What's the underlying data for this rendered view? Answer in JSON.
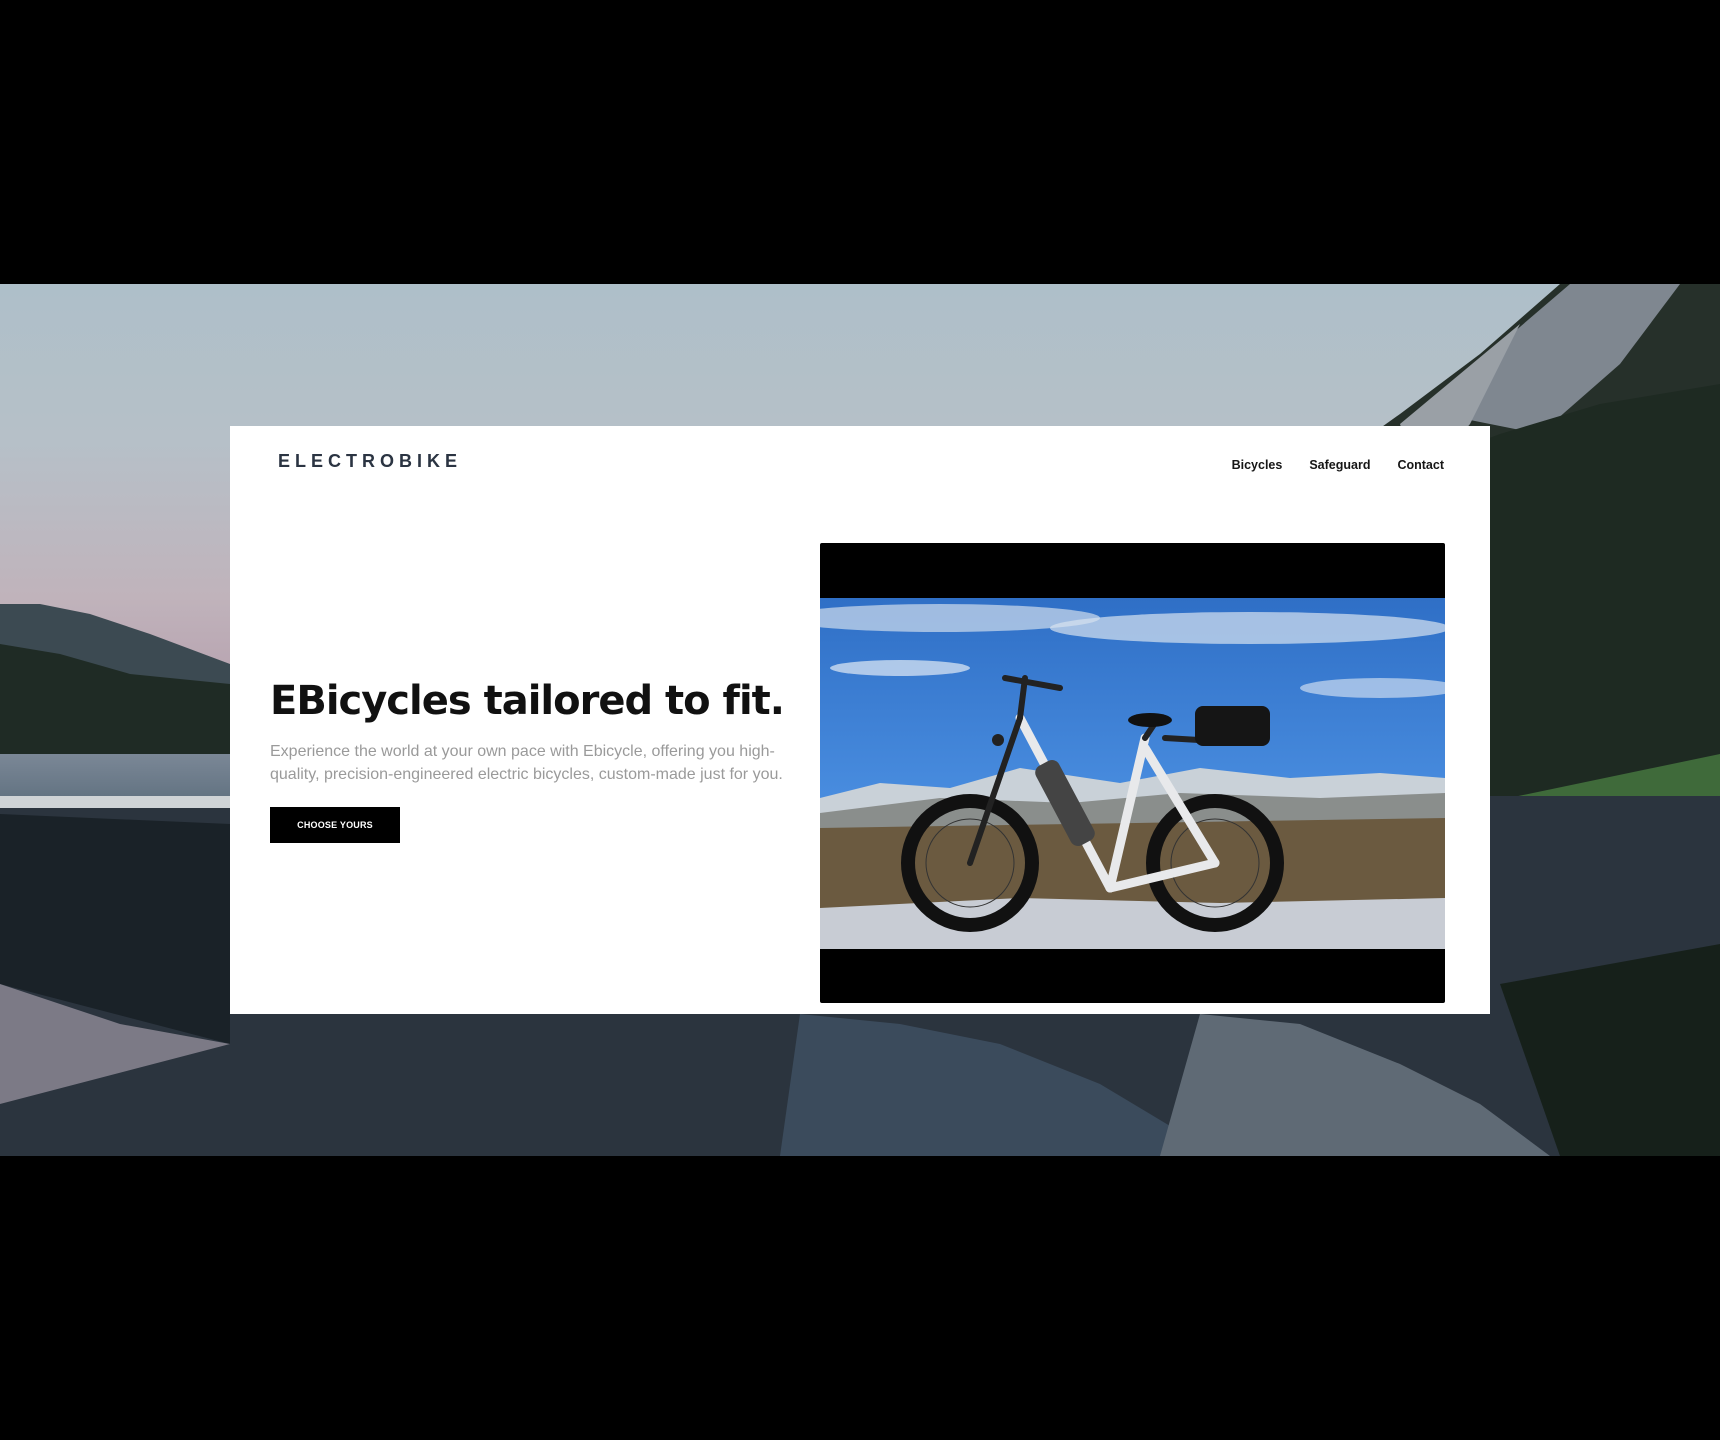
{
  "brand": {
    "logo_text": "ELECTROBIKE"
  },
  "nav": {
    "items": [
      "Bicycles",
      "Safeguard",
      "Contact"
    ]
  },
  "hero": {
    "title": "EBicycles tailored to fit.",
    "description": "Experience the world at your own pace with Ebicycle, offering you high-quality, precision-engineered electric bicycles, custom-made just for you.",
    "cta_label": "CHOOSE YOURS"
  },
  "colors": {
    "cta_background": "#000000",
    "title": "#111111",
    "body_text": "#9a9a9a",
    "sky": "#3f7ed1"
  }
}
